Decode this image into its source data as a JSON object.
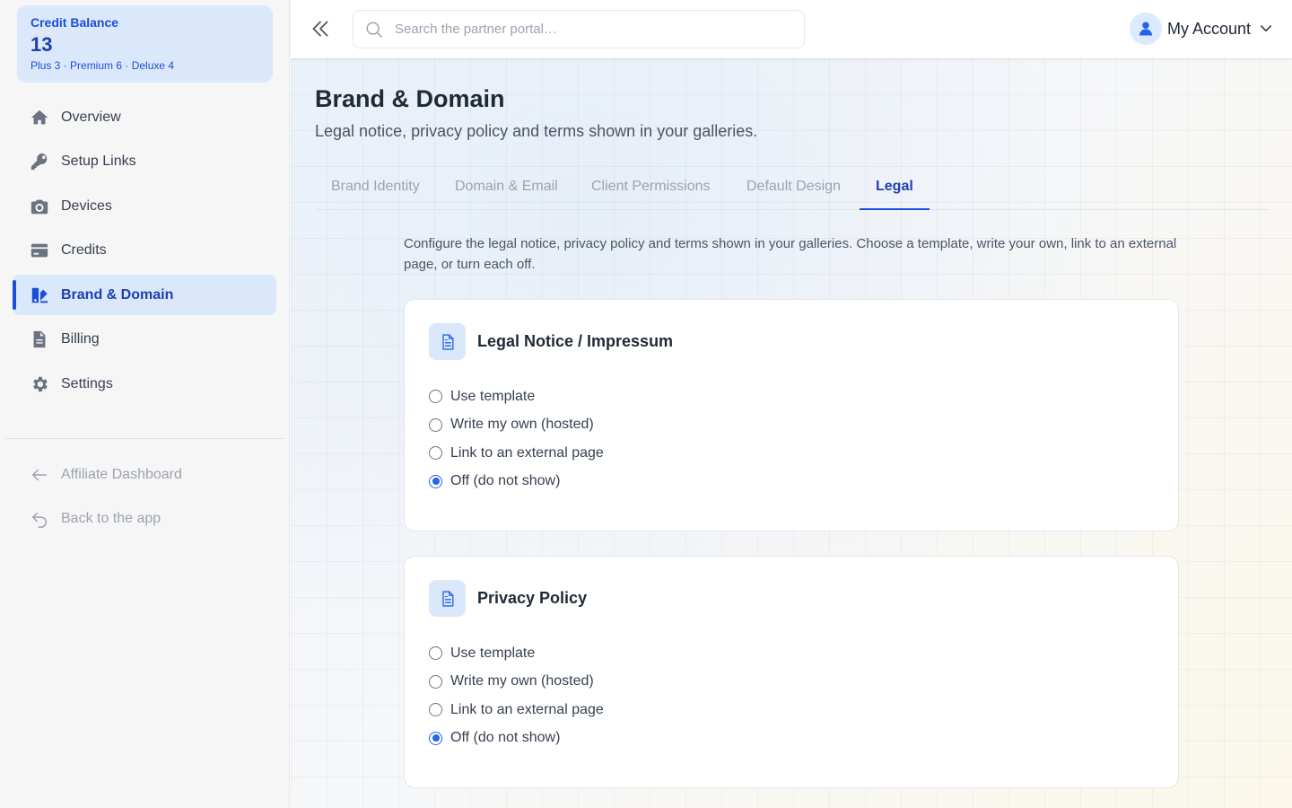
{
  "credit": {
    "title": "Credit Balance",
    "value": "13",
    "breakdown": "Plus 3 · Premium 6 · Deluxe 4"
  },
  "sidebar": {
    "items": [
      {
        "label": "Overview",
        "icon": "home-icon"
      },
      {
        "label": "Setup Links",
        "icon": "key-icon"
      },
      {
        "label": "Devices",
        "icon": "camera-icon"
      },
      {
        "label": "Credits",
        "icon": "credit-card-icon"
      },
      {
        "label": "Brand & Domain",
        "icon": "brand-icon",
        "active": true
      },
      {
        "label": "Billing",
        "icon": "document-icon"
      },
      {
        "label": "Settings",
        "icon": "gear-icon"
      }
    ],
    "secondary": [
      {
        "label": "Affiliate Dashboard",
        "icon": "arrow-left-icon"
      },
      {
        "label": "Back to the app",
        "icon": "return-icon"
      }
    ]
  },
  "topbar": {
    "search_placeholder": "Search the partner portal…",
    "account_label": "My Account"
  },
  "page": {
    "title": "Brand & Domain",
    "subtitle": "Legal notice, privacy policy and terms shown in your galleries.",
    "tabs": [
      {
        "label": "Brand Identity"
      },
      {
        "label": "Domain & Email"
      },
      {
        "label": "Client Permissions"
      },
      {
        "label": "Default Design"
      },
      {
        "label": "Legal",
        "active": true
      }
    ],
    "intro": "Configure the legal notice, privacy policy and terms shown in your galleries. Choose a template, write your own, link to an external page, or turn each off."
  },
  "cards": [
    {
      "title": "Legal Notice / Impressum",
      "options": [
        "Use template",
        "Write my own (hosted)",
        "Link to an external page",
        "Off (do not show)"
      ],
      "selected": 3
    },
    {
      "title": "Privacy Policy",
      "options": [
        "Use template",
        "Write my own (hosted)",
        "Link to an external page",
        "Off (do not show)"
      ],
      "selected": 3
    }
  ],
  "colors": {
    "accent": "#1d4ed8",
    "accent_bg": "#dbe8fb",
    "radio_checked": "#2563eb"
  }
}
